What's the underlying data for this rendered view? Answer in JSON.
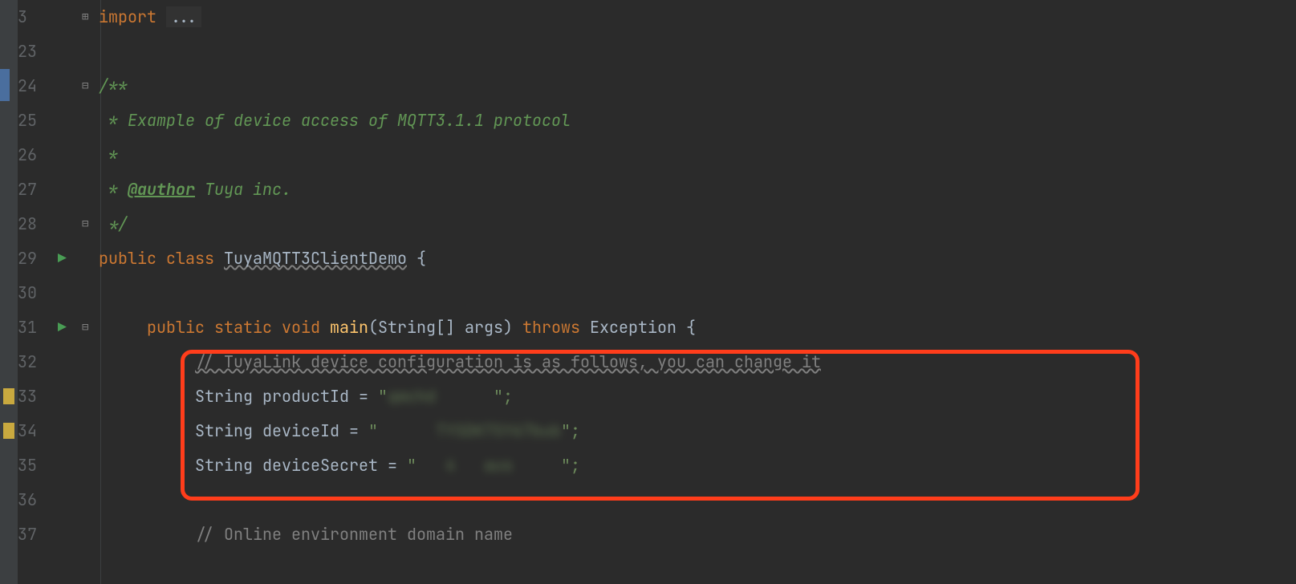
{
  "lineNumbers": [
    "3",
    "23",
    "24",
    "25",
    "26",
    "27",
    "28",
    "29",
    "30",
    "31",
    "32",
    "33",
    "34",
    "35",
    "36",
    "37"
  ],
  "runIcons": {
    "line29": "▶",
    "line31": "▶"
  },
  "foldIcons": {
    "line3": "⊞",
    "line24": "⊟",
    "line28": "⊟",
    "line29": "",
    "line31": "⊟"
  },
  "code": {
    "import": "import ",
    "importEllipsis": "...",
    "doc": {
      "open": "/**",
      "line1": " * Example of device access of MQTT3.1.1 protocol",
      "line2": " *",
      "tagPrefix": " * ",
      "authorTag": "@author",
      "authorName": " Tuya inc.",
      "close": " */"
    },
    "classDecl": {
      "public": "public",
      "class": "class",
      "name": "TuyaMQTT3ClientDemo",
      "brace": " {"
    },
    "mainDecl": {
      "public": "public",
      "static": "static",
      "void": "void",
      "name": "main",
      "params": "(String[] args)",
      "throws": "throws",
      "exc": "Exception {"
    },
    "comment1": "// TuyaLink device configuration is as follows, you can change it",
    "productIdLine": {
      "type": "String ",
      "var": "productId",
      "eq": " = ",
      "valOpen": "\"",
      "valBody": "qmchd      ",
      "valClose": "\";"
    },
    "deviceIdLine": {
      "type": "String ",
      "var": "deviceId",
      "eq": " = ",
      "valOpen": "\"",
      "valBody": "      TYSDK7SY67bub",
      "valClose": "\";"
    },
    "deviceSecretLine": {
      "type": "String ",
      "var": "deviceSecret",
      "eq": " = ",
      "valOpen": "\"",
      "valBody": "   4   aus     ",
      "valClose": "\";"
    },
    "comment2": "// Online environment domain name"
  }
}
